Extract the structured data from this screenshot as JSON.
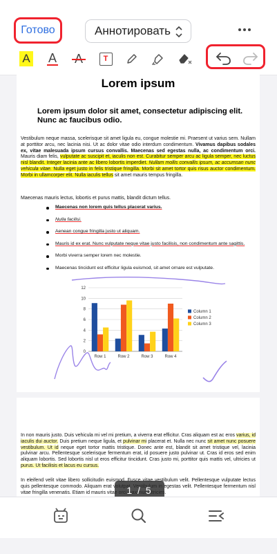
{
  "header": {
    "done_label": "Готово",
    "mode_label": "Аннотировать"
  },
  "toolbar": {
    "tools": [
      "highlight-tool",
      "underline-tool",
      "strikethrough-tool",
      "textbox-tool",
      "pencil-tool",
      "marker-tool",
      "eraser-tool"
    ],
    "highlight_glyph": "A",
    "underline_glyph": "A",
    "strike_glyph": "A",
    "textbox_glyph": "T",
    "colors": {
      "accent_red": "#f0222e",
      "highlight_yellow": "#fff71a",
      "link_blue": "#2f6fe0"
    }
  },
  "document": {
    "title": "Lorem ipsum",
    "subtitle": "Lorem ipsum dolor sit amet, consectetur adipiscing elit. Nunc ac faucibus odio.",
    "para1_a": "Vestibulum neque massa, scelerisque sit amet ligula eu, congue molestie mi. Praesent ut varius sem. Nullam at porttitor arcu, nec lacinia nisi. Ut ac dolor vitae odio interdum condimentum. ",
    "para1_b": "Vivamus dapibus sodales ex, vitae malesuada ipsum cursus convallis. Maecenas sed egestas nulla, ac condimentum orci.",
    "para1_c": " Mauris diam felis, ",
    "para1_hl": "vulputate ac suscipit et, iaculis non est. Curabitur semper arcu ac ligula semper, nec luctus nisl blandit. Integer lacinia ante ac libero lobortis imperdiet. ",
    "para1_hl_ital": "Nullam mollis convallis ipsum, ac accumsan nunc vehicula vitae.",
    "para1_hl2": " Nulla eget justo in felis tristique fringilla. Morbi sit amet tortor quis risus auctor condimentum. Morbi in ullamcorper elit. Nulla iaculis tellus",
    "para1_d": " sit amet mauris tempus fringilla.",
    "para2": "Maecenas mauris lectus, lobortis et purus mattis, blandit dictum tellus.",
    "bullets": [
      "Maecenas non lorem quis tellus placerat varius.",
      "Nulla facilisi.",
      "Aenean congue fringilla justo ut aliquam.",
      "Mauris id ex erat. Nunc vulputate neque vitae justo facilisis, non condimentum ante sagittis.",
      "Morbi viverra semper lorem nec molestie.",
      "Maecenas tincidunt est efficitur ligula euismod, sit amet ornare est vulputate."
    ],
    "page2_para1_a": "In non mauris justo. Duis vehicula mi vel mi pretium, a viverra erat efficitur. Cras aliquam est ac eros ",
    "page2_para1_hl1": "varius, id iaculis dui auctor.",
    "page2_para1_b": " Duis pretium neque ligula, et ",
    "page2_para1_hl2": "pulvinar mi",
    "page2_para1_c": " placerat et. Nulla nec nunc ",
    "page2_para1_hl3": "sit amet nunc posuere vestibulum. Ut id",
    "page2_para1_d": " neque eget tortor mattis tristique. Donec ante est, blandit sit amet tristique vel, lacinia pulvinar arcu. Pellentesque scelerisque fermentum erat, id posuere justo pulvinar ut. Cras id eros sed enim aliquam lobortis. Sed lobortis nisl ut eros efficitur tincidunt. Cras justo mi, porttitor quis mattis vel, ultricies ut ",
    "page2_para1_hl4": "purus. Ut facilisis et lacus eu cursus.",
    "page2_para2": "In eleifend velit vitae libero sollicitudin euismod. Fusce vitae vestibulum velit. Pellentesque vulputate lectus quis pellentesque commodo. Aliquam erat volutpat. Vestibulum in egestas velit. Pellentesque fermentum nisl vitae fringilla venenatis. Etiam id mauris vitae orci maximus ultricies."
  },
  "chart_data": {
    "type": "bar",
    "categories": [
      "Row 1",
      "Row 2",
      "Row 3",
      "Row 4"
    ],
    "series": [
      {
        "name": "Column 1",
        "values": [
          9.1,
          2.4,
          3.1,
          4.3
        ],
        "color": "#1f4e9e"
      },
      {
        "name": "Column 2",
        "values": [
          3.2,
          8.8,
          1.5,
          9.0
        ],
        "color": "#f05a1f"
      },
      {
        "name": "Column 3",
        "values": [
          4.5,
          9.6,
          3.7,
          6.2
        ],
        "color": "#ffd21a"
      }
    ],
    "ylim": [
      0,
      12
    ],
    "yticks": [
      "0",
      "2",
      "4",
      "6",
      "8",
      "10",
      "12"
    ],
    "grid": true,
    "legend": "right"
  },
  "pager": {
    "label": "1 / 5"
  },
  "bottom_nav": [
    "thumbnails-icon",
    "search-icon",
    "outline-icon"
  ]
}
